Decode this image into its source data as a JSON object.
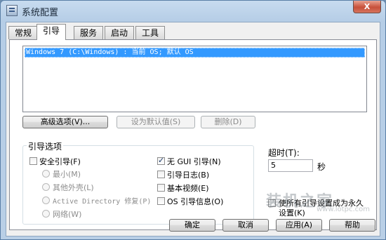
{
  "window": {
    "title": "系统配置",
    "close_label": "X"
  },
  "tabs": [
    "常规",
    "引导",
    "服务",
    "启动",
    "工具"
  ],
  "os_list": {
    "items": [
      "Windows 7 (C:\\Windows) : 当前 OS; 默认 OS"
    ]
  },
  "buttons": {
    "advanced": "高级选项(V)...",
    "set_default": "设为默认值(S)",
    "delete": "删除(D)"
  },
  "boot_options": {
    "label": "引导选项",
    "safe_boot": "安全引导(F)",
    "minimal": "最小(M)",
    "alternate_shell": "其他外壳(L)",
    "active_directory": "Active Directory 修复(P)",
    "network": "网络(W)",
    "no_gui": "无 GUI 引导(N)",
    "boot_log": "引导日志(B)",
    "base_video": "基本视频(E)",
    "os_boot_info": "OS 引导信息(O)"
  },
  "timeout": {
    "label": "超时(T):",
    "value": "5",
    "unit": "秒"
  },
  "permanent": {
    "line1": "使所有引导设置成为永久",
    "line2": "设置(K)"
  },
  "footer": {
    "ok": "确定",
    "cancel": "取消",
    "apply": "应用(A)",
    "help": "帮助"
  },
  "watermark": {
    "main": "装机之家",
    "sub": "www.lotpc.com"
  }
}
